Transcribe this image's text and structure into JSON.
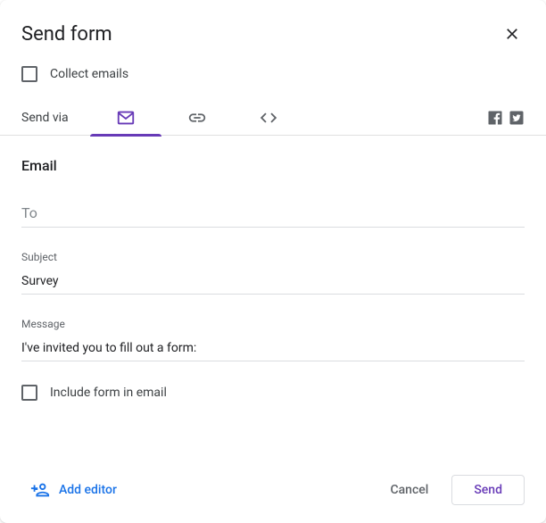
{
  "dialog": {
    "title": "Send form",
    "collect_emails_label": "Collect emails",
    "send_via_label": "Send via"
  },
  "section": {
    "title": "Email"
  },
  "fields": {
    "to_placeholder": "To",
    "to_value": "",
    "subject_label": "Subject",
    "subject_value": "Survey",
    "message_label": "Message",
    "message_value": "I've invited you to fill out a form:"
  },
  "include": {
    "label": "Include form in email"
  },
  "footer": {
    "add_editor_label": "Add editor",
    "cancel_label": "Cancel",
    "send_label": "Send"
  }
}
